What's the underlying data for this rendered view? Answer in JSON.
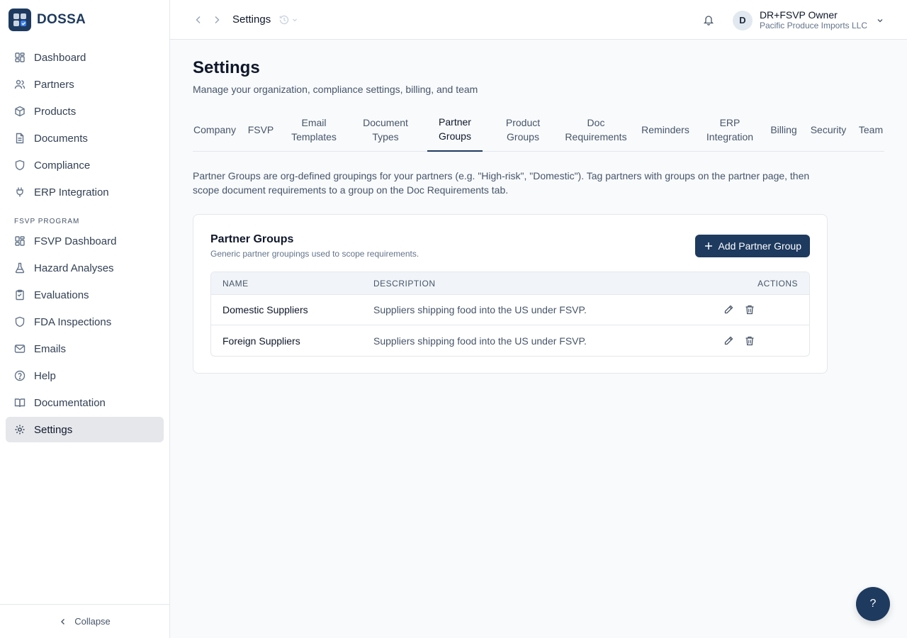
{
  "brand": {
    "name": "DOSSA"
  },
  "sidebar": {
    "items": [
      {
        "label": "Dashboard",
        "icon": "dashboard-icon"
      },
      {
        "label": "Partners",
        "icon": "users-icon"
      },
      {
        "label": "Products",
        "icon": "package-icon"
      },
      {
        "label": "Documents",
        "icon": "file-icon"
      },
      {
        "label": "Compliance",
        "icon": "shield-icon"
      },
      {
        "label": "ERP Integration",
        "icon": "plug-icon"
      }
    ],
    "section_label": "FSVP PROGRAM",
    "fsvp_items": [
      {
        "label": "FSVP Dashboard",
        "icon": "dashboard-icon"
      },
      {
        "label": "Hazard Analyses",
        "icon": "flask-icon"
      },
      {
        "label": "Evaluations",
        "icon": "clipboard-icon"
      },
      {
        "label": "FDA Inspections",
        "icon": "shield-icon"
      },
      {
        "label": "Emails",
        "icon": "mail-icon"
      },
      {
        "label": "Help",
        "icon": "help-circle-icon"
      },
      {
        "label": "Documentation",
        "icon": "book-icon"
      },
      {
        "label": "Settings",
        "icon": "gear-icon",
        "active": true
      }
    ],
    "collapse_label": "Collapse"
  },
  "header": {
    "breadcrumb": "Settings",
    "user": {
      "initial": "D",
      "name": "DR+FSVP Owner",
      "org": "Pacific Produce Imports LLC"
    }
  },
  "page": {
    "title": "Settings",
    "subtitle": "Manage your organization, compliance settings, billing, and team",
    "tabs": [
      {
        "label": "Company"
      },
      {
        "label": "FSVP"
      },
      {
        "label": "Email Templates"
      },
      {
        "label": "Document Types"
      },
      {
        "label": "Partner Groups",
        "active": true
      },
      {
        "label": "Product Groups"
      },
      {
        "label": "Doc Requirements"
      },
      {
        "label": "Reminders"
      },
      {
        "label": "ERP Integration"
      },
      {
        "label": "Billing"
      },
      {
        "label": "Security"
      },
      {
        "label": "Team"
      }
    ],
    "intro": "Partner Groups are org-defined groupings for your partners (e.g. \"High-risk\", \"Domestic\"). Tag partners with groups on the partner page, then scope document requirements to a group on the Doc Requirements tab."
  },
  "card": {
    "title": "Partner Groups",
    "subtitle": "Generic partner groupings used to scope requirements.",
    "add_label": "Add Partner Group",
    "columns": {
      "name": "NAME",
      "description": "DESCRIPTION",
      "actions": "ACTIONS"
    },
    "rows": [
      {
        "name": "Domestic Suppliers",
        "description": "Suppliers shipping food into the US under FSVP."
      },
      {
        "name": "Foreign Suppliers",
        "description": "Suppliers shipping food into the US under FSVP."
      }
    ]
  },
  "help_fab": {
    "label": "?"
  },
  "colors": {
    "brand": "#1e3a5f",
    "active_nav_bg": "#e5e7eb"
  }
}
